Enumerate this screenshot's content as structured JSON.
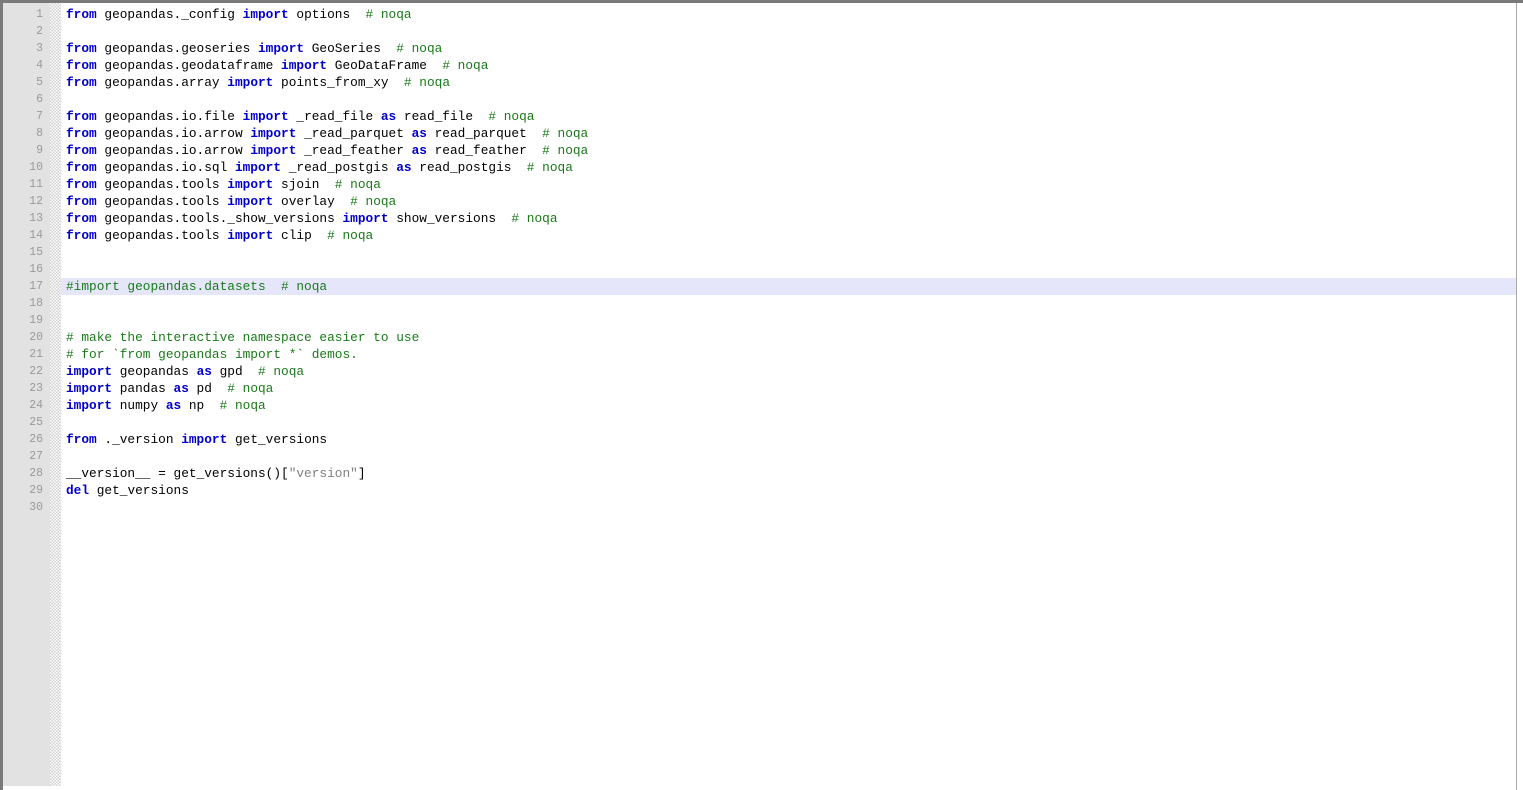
{
  "editor": {
    "language": "python",
    "gutter": {
      "first_line": 1,
      "last_line": 30,
      "line_numbers": [
        1,
        2,
        3,
        4,
        5,
        6,
        7,
        8,
        9,
        10,
        11,
        12,
        13,
        14,
        15,
        16,
        17,
        18,
        19,
        20,
        21,
        22,
        23,
        24,
        25,
        26,
        27,
        28,
        29,
        30
      ]
    },
    "highlighted_line": 17,
    "colors": {
      "background": "#ffffff",
      "gutter_background": "#e2e2e2",
      "gutter_text": "#9a9a9a",
      "keyword": "#0000cd",
      "comment": "#1a7a1a",
      "string": "#808080",
      "plain": "#000000",
      "current_line_highlight": "#e6e6fa",
      "border": "#7a7a7a"
    },
    "lines": [
      {
        "number": 1,
        "text": "from geopandas._config import options  # noqa",
        "tokens": [
          {
            "t": "from",
            "c": "kw"
          },
          {
            "t": " geopandas._config ",
            "c": "pl"
          },
          {
            "t": "import",
            "c": "kw"
          },
          {
            "t": " options  ",
            "c": "pl"
          },
          {
            "t": "# noqa",
            "c": "cm"
          }
        ]
      },
      {
        "number": 2,
        "text": "",
        "tokens": []
      },
      {
        "number": 3,
        "text": "from geopandas.geoseries import GeoSeries  # noqa",
        "tokens": [
          {
            "t": "from",
            "c": "kw"
          },
          {
            "t": " geopandas.geoseries ",
            "c": "pl"
          },
          {
            "t": "import",
            "c": "kw"
          },
          {
            "t": " GeoSeries  ",
            "c": "pl"
          },
          {
            "t": "# noqa",
            "c": "cm"
          }
        ]
      },
      {
        "number": 4,
        "text": "from geopandas.geodataframe import GeoDataFrame  # noqa",
        "tokens": [
          {
            "t": "from",
            "c": "kw"
          },
          {
            "t": " geopandas.geodataframe ",
            "c": "pl"
          },
          {
            "t": "import",
            "c": "kw"
          },
          {
            "t": " GeoDataFrame  ",
            "c": "pl"
          },
          {
            "t": "# noqa",
            "c": "cm"
          }
        ]
      },
      {
        "number": 5,
        "text": "from geopandas.array import points_from_xy  # noqa",
        "tokens": [
          {
            "t": "from",
            "c": "kw"
          },
          {
            "t": " geopandas.array ",
            "c": "pl"
          },
          {
            "t": "import",
            "c": "kw"
          },
          {
            "t": " points_from_xy  ",
            "c": "pl"
          },
          {
            "t": "# noqa",
            "c": "cm"
          }
        ]
      },
      {
        "number": 6,
        "text": "",
        "tokens": []
      },
      {
        "number": 7,
        "text": "from geopandas.io.file import _read_file as read_file  # noqa",
        "tokens": [
          {
            "t": "from",
            "c": "kw"
          },
          {
            "t": " geopandas.io.file ",
            "c": "pl"
          },
          {
            "t": "import",
            "c": "kw"
          },
          {
            "t": " _read_file ",
            "c": "pl"
          },
          {
            "t": "as",
            "c": "kw"
          },
          {
            "t": " read_file  ",
            "c": "pl"
          },
          {
            "t": "# noqa",
            "c": "cm"
          }
        ]
      },
      {
        "number": 8,
        "text": "from geopandas.io.arrow import _read_parquet as read_parquet  # noqa",
        "tokens": [
          {
            "t": "from",
            "c": "kw"
          },
          {
            "t": " geopandas.io.arrow ",
            "c": "pl"
          },
          {
            "t": "import",
            "c": "kw"
          },
          {
            "t": " _read_parquet ",
            "c": "pl"
          },
          {
            "t": "as",
            "c": "kw"
          },
          {
            "t": " read_parquet  ",
            "c": "pl"
          },
          {
            "t": "# noqa",
            "c": "cm"
          }
        ]
      },
      {
        "number": 9,
        "text": "from geopandas.io.arrow import _read_feather as read_feather  # noqa",
        "tokens": [
          {
            "t": "from",
            "c": "kw"
          },
          {
            "t": " geopandas.io.arrow ",
            "c": "pl"
          },
          {
            "t": "import",
            "c": "kw"
          },
          {
            "t": " _read_feather ",
            "c": "pl"
          },
          {
            "t": "as",
            "c": "kw"
          },
          {
            "t": " read_feather  ",
            "c": "pl"
          },
          {
            "t": "# noqa",
            "c": "cm"
          }
        ]
      },
      {
        "number": 10,
        "text": "from geopandas.io.sql import _read_postgis as read_postgis  # noqa",
        "tokens": [
          {
            "t": "from",
            "c": "kw"
          },
          {
            "t": " geopandas.io.sql ",
            "c": "pl"
          },
          {
            "t": "import",
            "c": "kw"
          },
          {
            "t": " _read_postgis ",
            "c": "pl"
          },
          {
            "t": "as",
            "c": "kw"
          },
          {
            "t": " read_postgis  ",
            "c": "pl"
          },
          {
            "t": "# noqa",
            "c": "cm"
          }
        ]
      },
      {
        "number": 11,
        "text": "from geopandas.tools import sjoin  # noqa",
        "tokens": [
          {
            "t": "from",
            "c": "kw"
          },
          {
            "t": " geopandas.tools ",
            "c": "pl"
          },
          {
            "t": "import",
            "c": "kw"
          },
          {
            "t": " sjoin  ",
            "c": "pl"
          },
          {
            "t": "# noqa",
            "c": "cm"
          }
        ]
      },
      {
        "number": 12,
        "text": "from geopandas.tools import overlay  # noqa",
        "tokens": [
          {
            "t": "from",
            "c": "kw"
          },
          {
            "t": " geopandas.tools ",
            "c": "pl"
          },
          {
            "t": "import",
            "c": "kw"
          },
          {
            "t": " overlay  ",
            "c": "pl"
          },
          {
            "t": "# noqa",
            "c": "cm"
          }
        ]
      },
      {
        "number": 13,
        "text": "from geopandas.tools._show_versions import show_versions  # noqa",
        "tokens": [
          {
            "t": "from",
            "c": "kw"
          },
          {
            "t": " geopandas.tools._show_versions ",
            "c": "pl"
          },
          {
            "t": "import",
            "c": "kw"
          },
          {
            "t": " show_versions  ",
            "c": "pl"
          },
          {
            "t": "# noqa",
            "c": "cm"
          }
        ]
      },
      {
        "number": 14,
        "text": "from geopandas.tools import clip  # noqa",
        "tokens": [
          {
            "t": "from",
            "c": "kw"
          },
          {
            "t": " geopandas.tools ",
            "c": "pl"
          },
          {
            "t": "import",
            "c": "kw"
          },
          {
            "t": " clip  ",
            "c": "pl"
          },
          {
            "t": "# noqa",
            "c": "cm"
          }
        ]
      },
      {
        "number": 15,
        "text": "",
        "tokens": []
      },
      {
        "number": 16,
        "text": "",
        "tokens": []
      },
      {
        "number": 17,
        "text": "#import geopandas.datasets  # noqa",
        "highlighted": true,
        "tokens": [
          {
            "t": "#import geopandas.datasets  # noqa",
            "c": "cm"
          }
        ]
      },
      {
        "number": 18,
        "text": "",
        "tokens": []
      },
      {
        "number": 19,
        "text": "",
        "tokens": []
      },
      {
        "number": 20,
        "text": "# make the interactive namespace easier to use",
        "tokens": [
          {
            "t": "# make the interactive namespace easier to use",
            "c": "cm"
          }
        ]
      },
      {
        "number": 21,
        "text": "# for `from geopandas import *` demos.",
        "tokens": [
          {
            "t": "# for `from geopandas import *` demos.",
            "c": "cm"
          }
        ]
      },
      {
        "number": 22,
        "text": "import geopandas as gpd  # noqa",
        "tokens": [
          {
            "t": "import",
            "c": "kw"
          },
          {
            "t": " geopandas ",
            "c": "pl"
          },
          {
            "t": "as",
            "c": "kw"
          },
          {
            "t": " gpd  ",
            "c": "pl"
          },
          {
            "t": "# noqa",
            "c": "cm"
          }
        ]
      },
      {
        "number": 23,
        "text": "import pandas as pd  # noqa",
        "tokens": [
          {
            "t": "import",
            "c": "kw"
          },
          {
            "t": " pandas ",
            "c": "pl"
          },
          {
            "t": "as",
            "c": "kw"
          },
          {
            "t": " pd  ",
            "c": "pl"
          },
          {
            "t": "# noqa",
            "c": "cm"
          }
        ]
      },
      {
        "number": 24,
        "text": "import numpy as np  # noqa",
        "tokens": [
          {
            "t": "import",
            "c": "kw"
          },
          {
            "t": " numpy ",
            "c": "pl"
          },
          {
            "t": "as",
            "c": "kw"
          },
          {
            "t": " np  ",
            "c": "pl"
          },
          {
            "t": "# noqa",
            "c": "cm"
          }
        ]
      },
      {
        "number": 25,
        "text": "",
        "tokens": []
      },
      {
        "number": 26,
        "text": "from ._version import get_versions",
        "tokens": [
          {
            "t": "from",
            "c": "kw"
          },
          {
            "t": " ._version ",
            "c": "pl"
          },
          {
            "t": "import",
            "c": "kw"
          },
          {
            "t": " get_versions",
            "c": "pl"
          }
        ]
      },
      {
        "number": 27,
        "text": "",
        "tokens": []
      },
      {
        "number": 28,
        "text": "__version__ = get_versions()[\"version\"]",
        "tokens": [
          {
            "t": "__version__ = get_versions()[",
            "c": "pl"
          },
          {
            "t": "\"version\"",
            "c": "st"
          },
          {
            "t": "]",
            "c": "pl"
          }
        ]
      },
      {
        "number": 29,
        "text": "del get_versions",
        "tokens": [
          {
            "t": "del",
            "c": "kw"
          },
          {
            "t": " get_versions",
            "c": "pl"
          }
        ]
      },
      {
        "number": 30,
        "text": "",
        "tokens": []
      }
    ]
  }
}
